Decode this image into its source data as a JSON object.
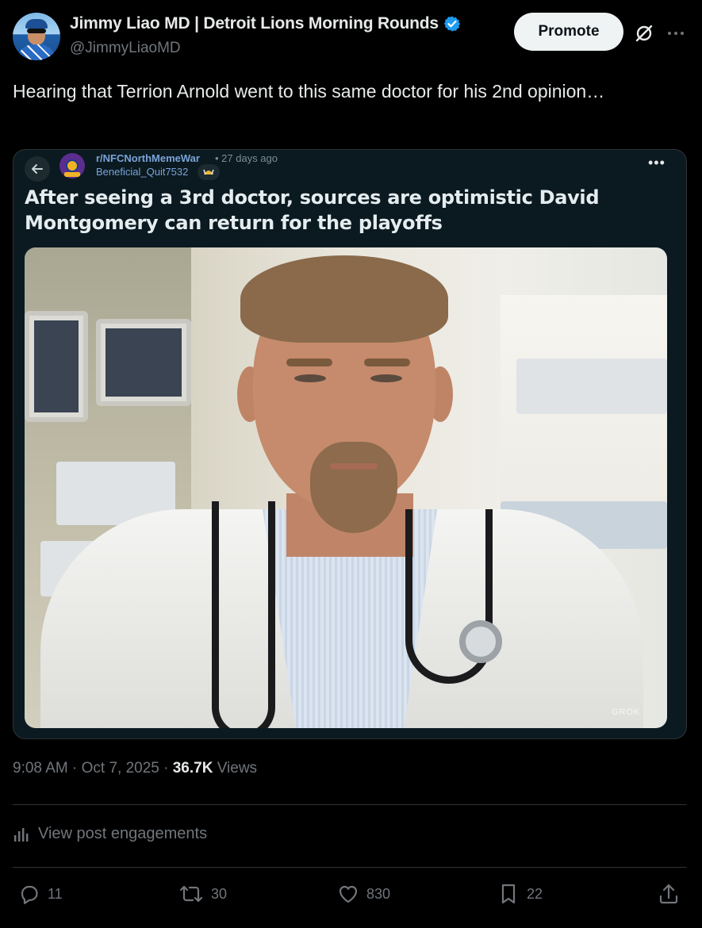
{
  "author": {
    "display_name": "Jimmy Liao MD | Detroit Lions Morning Rounds",
    "handle": "@JimmyLiaoMD",
    "verified": true,
    "verified_color": "#1d9bf0"
  },
  "header_actions": {
    "promote_label": "Promote",
    "grok_icon": "grok-icon",
    "more_icon": "more-icon"
  },
  "tweet": {
    "text": "Hearing that Terrion Arnold went to this same doctor for his 2nd opinion…"
  },
  "media": {
    "subreddit": "r/NFCNorthMemeWar",
    "age": "• 27 days ago",
    "username": "Beneficial_Quit7532",
    "more_label": "•••",
    "title": "After seeing a 3rd doctor, sources are optimistic David Montgomery can return for the playoffs",
    "photo_watermark": "GROK"
  },
  "meta": {
    "time": "9:08 AM",
    "date": "Oct 7, 2025",
    "views_count": "36.7K",
    "views_label": "Views"
  },
  "engagements": {
    "label": "View post engagements"
  },
  "actions": {
    "replies": "11",
    "reposts": "30",
    "likes": "830",
    "bookmarks": "22"
  },
  "colors": {
    "background": "#000000",
    "text_primary": "#e7e9ea",
    "text_secondary": "#71767b",
    "border": "#2f3336",
    "accent": "#1d9bf0"
  }
}
